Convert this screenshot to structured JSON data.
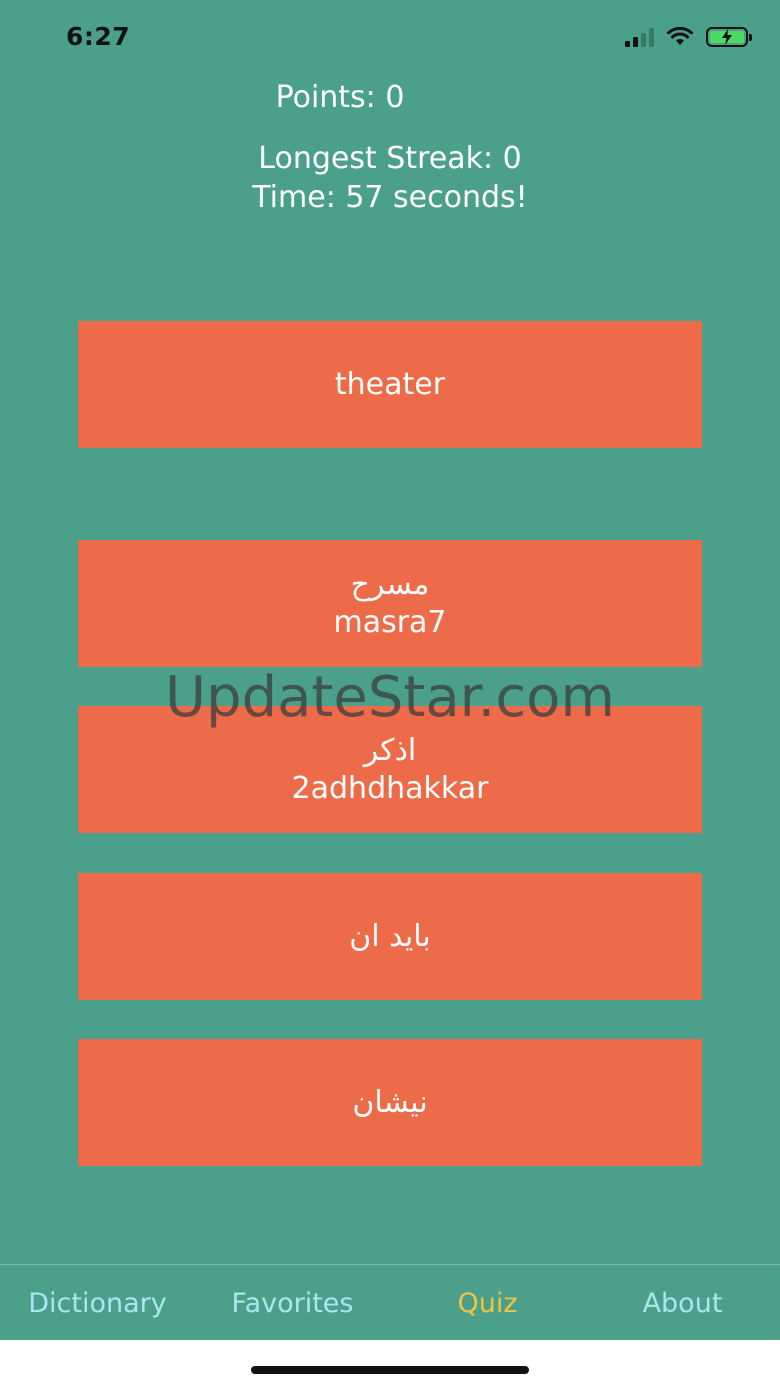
{
  "status": {
    "time": "6:27"
  },
  "stats": {
    "points": "Points: 0",
    "streak": "Longest Streak: 0",
    "timer": "Time: 57 seconds!"
  },
  "question": {
    "word": "theater"
  },
  "options": [
    {
      "arabic": "مسرح",
      "transliteration": "masra7"
    },
    {
      "arabic": "اذكر",
      "transliteration": "2adhdhakkar"
    },
    {
      "arabic": "بايد ان",
      "transliteration": ""
    },
    {
      "arabic": "نيشان",
      "transliteration": ""
    }
  ],
  "watermark": "UpdateStar.com",
  "tabs": [
    {
      "label": "Dictionary"
    },
    {
      "label": "Favorites"
    },
    {
      "label": "Quiz"
    },
    {
      "label": "About"
    }
  ],
  "colors": {
    "background": "#4aa08a",
    "card": "#ee6b4a",
    "tab_inactive": "#a9e7ef",
    "tab_active": "#f2c244"
  }
}
